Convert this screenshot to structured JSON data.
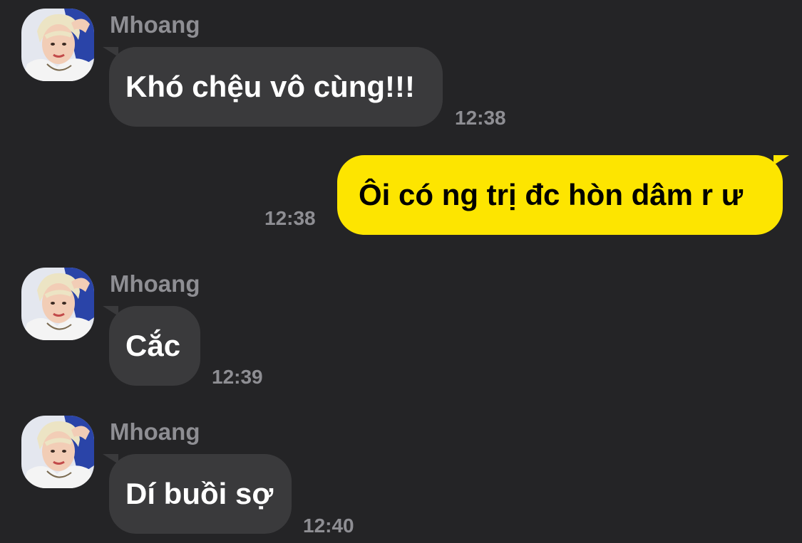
{
  "messages": [
    {
      "sender": "Mhoang",
      "text": "Khó chệu vô cùng!!!",
      "time": "12:38",
      "direction": "incoming",
      "avatar": "profile-photo"
    },
    {
      "text": "Ôi có ng trị đc hòn dâm r ư",
      "time": "12:38",
      "direction": "outgoing"
    },
    {
      "sender": "Mhoang",
      "text": "Cắc",
      "time": "12:39",
      "direction": "incoming",
      "avatar": "profile-photo"
    },
    {
      "sender": "Mhoang",
      "text": "Dí buồi sợ",
      "time": "12:40",
      "direction": "incoming",
      "avatar": "profile-photo"
    }
  ],
  "colors": {
    "background": "#242426",
    "incoming_bubble": "#3a3a3c",
    "outgoing_bubble": "#fde500",
    "meta_text": "#8e8e93"
  }
}
